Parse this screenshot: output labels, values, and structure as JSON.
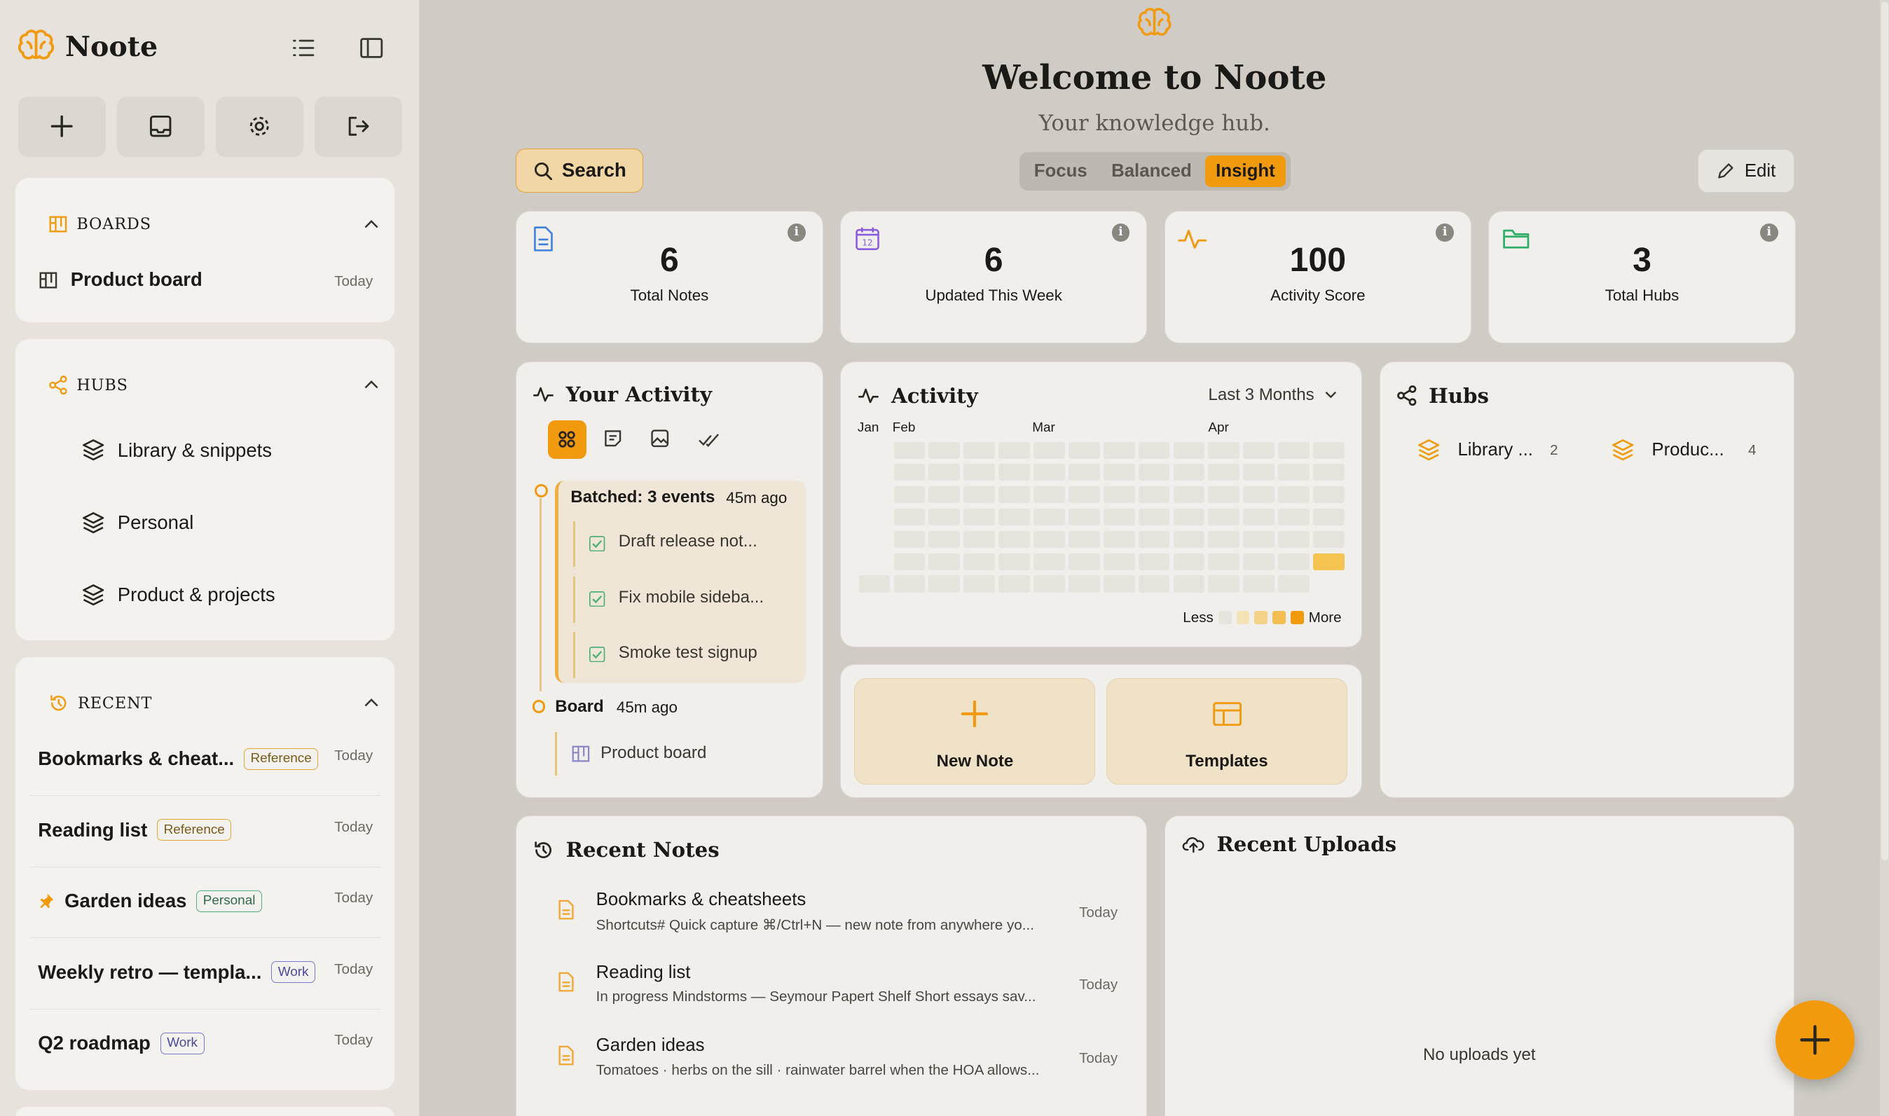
{
  "app": {
    "name": "Noote"
  },
  "sidebar": {
    "quick_actions": [
      {
        "icon": "plus-icon"
      },
      {
        "icon": "inbox-icon"
      },
      {
        "icon": "gear-icon"
      },
      {
        "icon": "logout-icon"
      }
    ],
    "boards": {
      "title": "BOARDS",
      "items": [
        {
          "label": "Product board",
          "date": "Today"
        }
      ]
    },
    "hubs": {
      "title": "HUBS",
      "items": [
        {
          "label": "Library & snippets"
        },
        {
          "label": "Personal"
        },
        {
          "label": "Product & projects"
        }
      ]
    },
    "recent": {
      "title": "RECENT",
      "items": [
        {
          "label": "Bookmarks & cheat...",
          "tag": "Reference",
          "date": "Today"
        },
        {
          "label": "Reading list",
          "tag": "Reference",
          "date": "Today"
        },
        {
          "label": "Garden ideas",
          "tag": "Personal",
          "date": "Today",
          "pinned": true
        },
        {
          "label": "Weekly retro — templa...",
          "tag": "Work",
          "date": "Today"
        },
        {
          "label": "Q2 roadmap",
          "tag": "Work",
          "date": "Today"
        }
      ]
    }
  },
  "header": {
    "title": "Welcome to Noote",
    "subtitle": "Your knowledge hub.",
    "search_label": "Search",
    "edit_label": "Edit",
    "modes": [
      "Focus",
      "Balanced",
      "Insight"
    ],
    "active_mode": "Insight"
  },
  "stats": [
    {
      "value": "6",
      "label": "Total Notes",
      "icon": "document-icon",
      "color": "#3f7fe0"
    },
    {
      "value": "6",
      "label": "Updated This Week",
      "icon": "calendar-icon",
      "color": "#8a5ce0",
      "badge": "12"
    },
    {
      "value": "100",
      "label": "Activity Score",
      "icon": "pulse-icon",
      "color": "#f29a0e"
    },
    {
      "value": "3",
      "label": "Total Hubs",
      "icon": "folder-icon",
      "color": "#2fae6a"
    }
  ],
  "your_activity": {
    "title": "Your Activity",
    "batch": {
      "title": "Batched: 3 events",
      "time": "45m ago",
      "items": [
        "Draft release not...",
        "Fix mobile sideba...",
        "Smoke test signup"
      ]
    },
    "board": {
      "title": "Board",
      "time": "45m ago",
      "item": "Product board"
    }
  },
  "activity": {
    "title": "Activity",
    "range": "Last 3 Months",
    "months": [
      "Jan",
      "Feb",
      "Mar",
      "Apr"
    ],
    "legend_less": "Less",
    "legend_more": "More"
  },
  "quick": {
    "new_note": "New Note",
    "templates": "Templates"
  },
  "hubs_card": {
    "title": "Hubs",
    "items": [
      {
        "label": "Library ...",
        "count": "2"
      },
      {
        "label": "Produc...",
        "count": "4"
      }
    ]
  },
  "recent_notes": {
    "title": "Recent Notes",
    "items": [
      {
        "title": "Bookmarks & cheatsheets",
        "snippet": "Shortcuts# Quick capture ⌘/Ctrl+N — new note from anywhere yo...",
        "date": "Today"
      },
      {
        "title": "Reading list",
        "snippet": "In progress Mindstorms — Seymour Papert Shelf Short essays sav...",
        "date": "Today"
      },
      {
        "title": "Garden ideas",
        "snippet": "Tomatoes · herbs on the sill · rainwater barrel when the HOA allows...",
        "date": "Today"
      }
    ]
  },
  "recent_uploads": {
    "title": "Recent Uploads",
    "empty": "No uploads yet"
  }
}
